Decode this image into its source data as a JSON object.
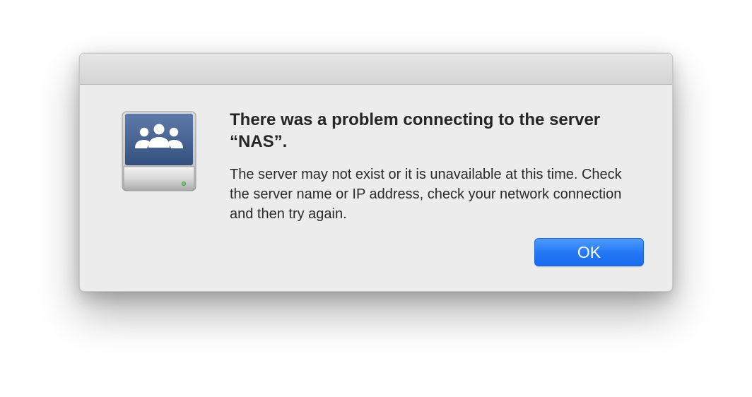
{
  "dialog": {
    "icon": "network-server-drive-icon",
    "heading": "There was a problem connecting to the server “NAS”.",
    "message": "The server may not exist or it is unavailable at this time. Check the server name or IP address, check your network connection and then try again.",
    "ok_label": "OK"
  },
  "colors": {
    "dialog_background": "#ececec",
    "titlebar": "#dcdcdc",
    "accent_button": "#2276f5",
    "icon_panel": "#3d5a8a"
  }
}
